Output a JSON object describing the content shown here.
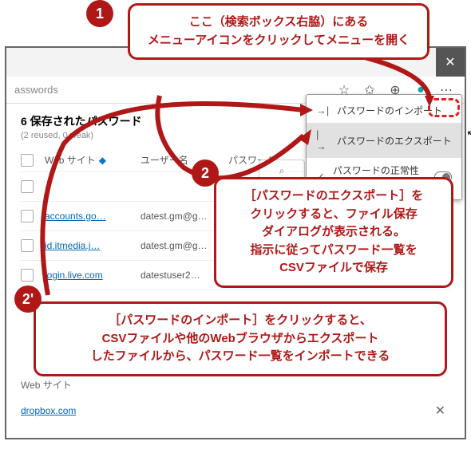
{
  "address_fragment": "asswords",
  "title": "6 保存されたパスワード",
  "subtitle": "(2 reused, 0 weak)",
  "columns": {
    "site": "Web サイト",
    "user": "ユーザー名",
    "pass": "パスワード"
  },
  "rows": [
    {
      "site": " ",
      "user": " ",
      "pass": "•••••••••",
      "blur": true,
      "eye": true
    },
    {
      "site": "accounts.go…",
      "user": "datest.gm@g…",
      "pass": "",
      "blur": false
    },
    {
      "site": "id.itmedia.j…",
      "user": "datest.gm@g…",
      "pass": "",
      "blur": false
    },
    {
      "site": "login.live.com",
      "user": "datestuser2…",
      "pass": "",
      "blur": false
    },
    {
      "site": " ",
      "user": " ",
      "pass": "",
      "blur": true
    }
  ],
  "menu": {
    "import": "パスワードのインポート",
    "export": "パスワードのエクスポート",
    "health": "パスワードの正常性を表示する"
  },
  "callout1": "ここ（検索ボックス右脇）にある\nメニューアイコンをクリックしてメニューを開く",
  "callout2": "［パスワードのエクスポート］を\nクリックすると、ファイル保存\nダイアログが表示される。\n指示に従ってパスワード一覧を\nCSVファイルで保存",
  "callout3": "［パスワードのインポート］をクリックすると、\nCSVファイルや他のWebブラウザからエクスポート\nしたファイルから、パスワード一覧をインポートできる",
  "section2": {
    "label": "Web サイト",
    "site": "dropbox.com"
  },
  "badges": {
    "b1": "1",
    "b2": "2",
    "b2p": "2'"
  }
}
